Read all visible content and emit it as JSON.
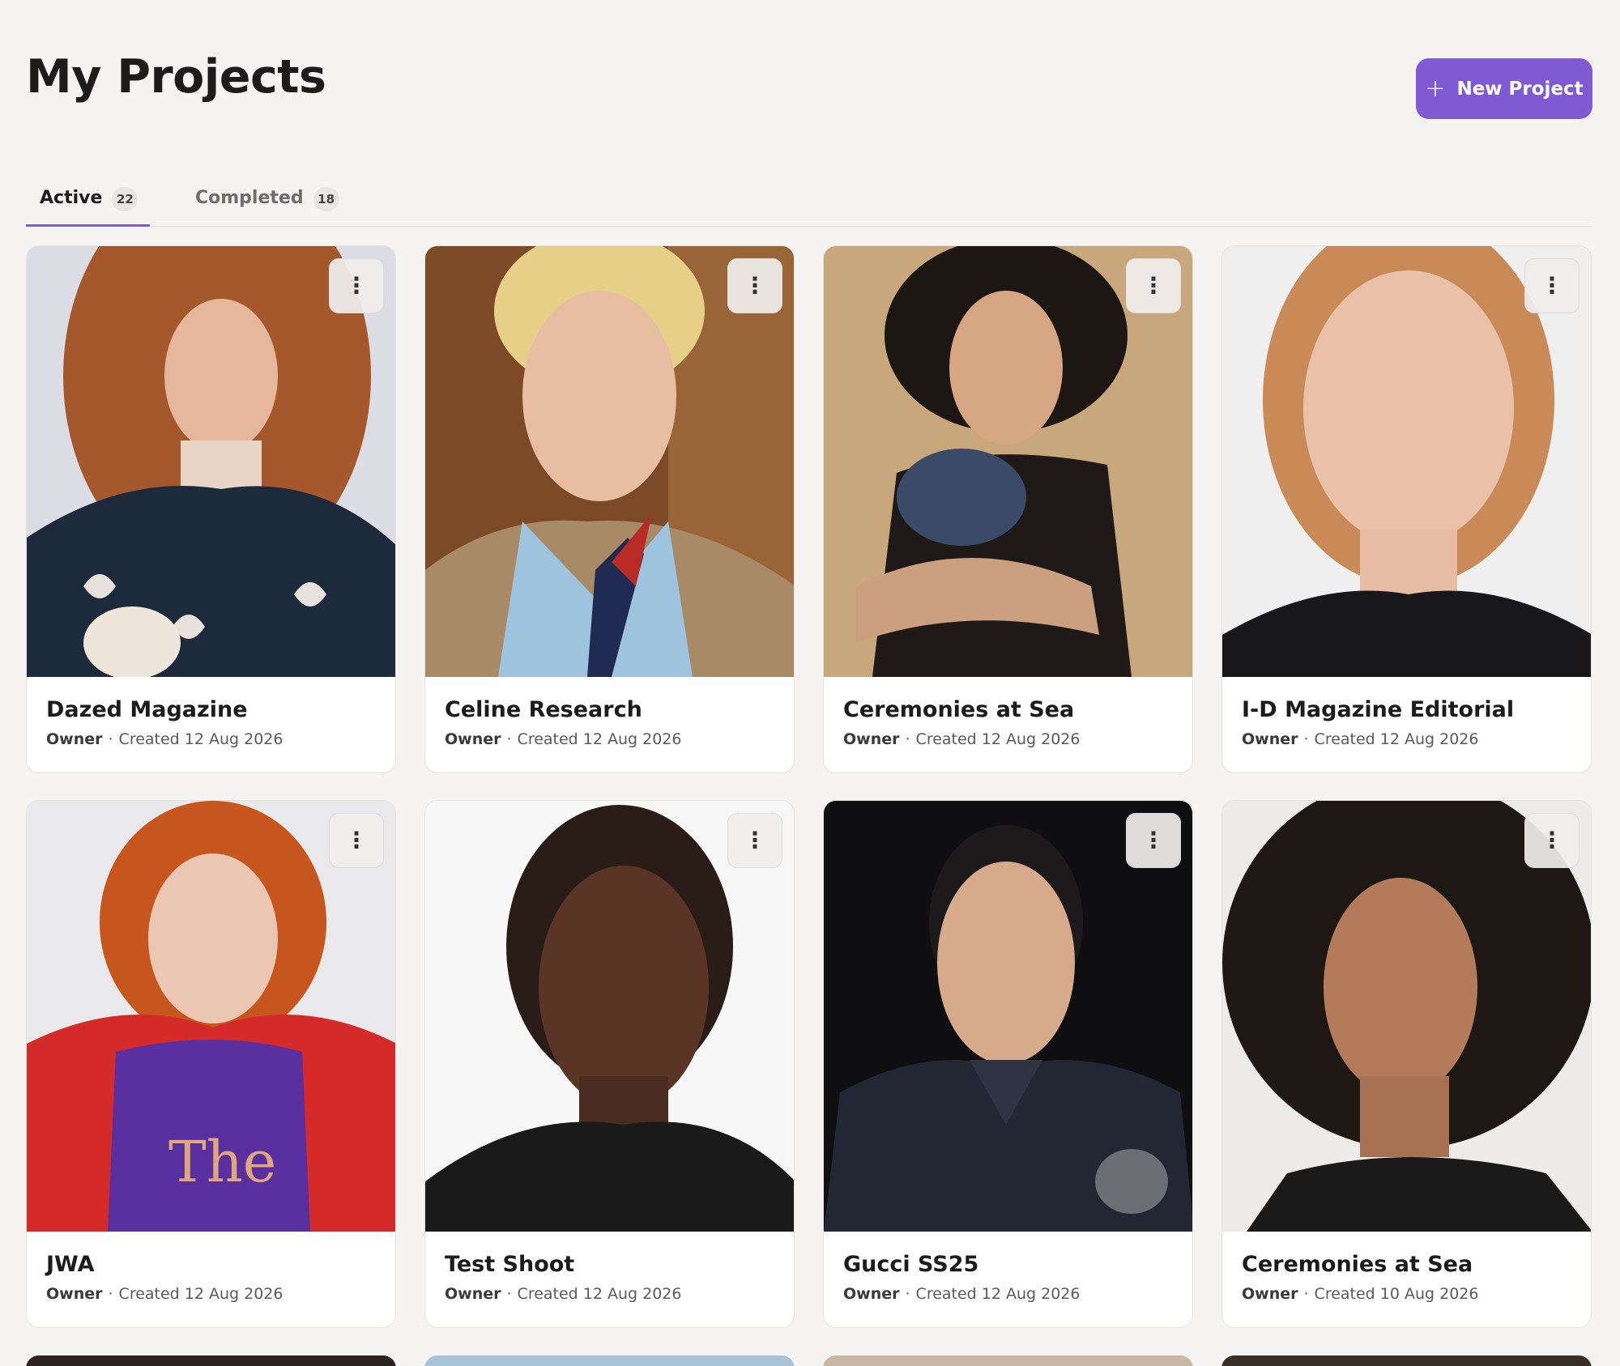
{
  "header": {
    "title": "My Projects",
    "new_project_label": "New Project"
  },
  "tabs": [
    {
      "label": "Active",
      "count": "22"
    },
    {
      "label": "Completed",
      "count": "18"
    }
  ],
  "projects": [
    {
      "title": "Dazed Magazine",
      "role": "Owner",
      "created": "Created 12 Aug 2026"
    },
    {
      "title": "Celine Research",
      "role": "Owner",
      "created": "Created 12 Aug 2026"
    },
    {
      "title": "Ceremonies at Sea",
      "role": "Owner",
      "created": "Created 12 Aug 2026"
    },
    {
      "title": "I-D Magazine Editorial",
      "role": "Owner",
      "created": "Created 12 Aug 2026"
    },
    {
      "title": "JWA",
      "role": "Owner",
      "created": "Created 12 Aug 2026"
    },
    {
      "title": "Test Shoot",
      "role": "Owner",
      "created": "Created 12 Aug 2026"
    },
    {
      "title": "Gucci SS25",
      "role": "Owner",
      "created": "Created 12 Aug 2026"
    },
    {
      "title": "Ceremonies at Sea",
      "role": "Owner",
      "created": "Created 10 Aug 2026"
    }
  ],
  "colors": {
    "accent": "#7f5ad3",
    "background": "#f5f4f2"
  },
  "icons": {
    "new_project": "plus-icon",
    "card_menu": "more-vertical-icon"
  }
}
